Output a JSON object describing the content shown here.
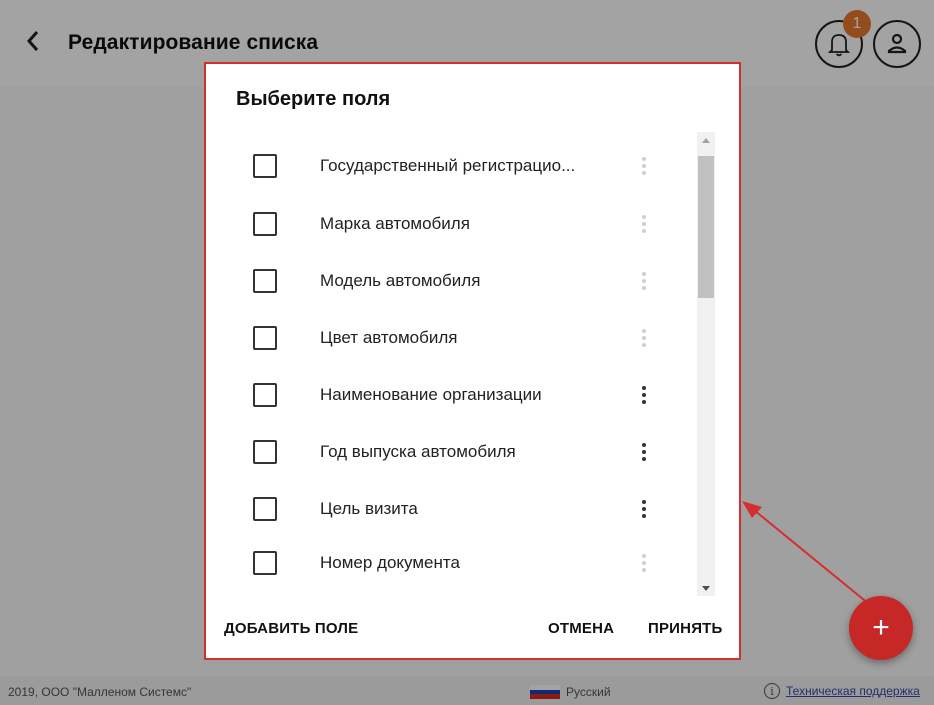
{
  "header": {
    "title": "Редактирование списка",
    "notifications_count": "1"
  },
  "dialog": {
    "title": "Выберите поля",
    "fields": [
      {
        "label": "Государственный регистрацио...",
        "checked": false,
        "handle": "faded"
      },
      {
        "label": "Марка автомобиля",
        "checked": false,
        "handle": "faded"
      },
      {
        "label": "Модель автомобиля",
        "checked": false,
        "handle": "faded"
      },
      {
        "label": "Цвет автомобиля",
        "checked": false,
        "handle": "faded"
      },
      {
        "label": "Наименование организации",
        "checked": false,
        "handle": "active"
      },
      {
        "label": "Год выпуска автомобиля",
        "checked": false,
        "handle": "active"
      },
      {
        "label": "Цель визита",
        "checked": false,
        "handle": "active"
      },
      {
        "label": "Номер документа",
        "checked": false,
        "handle": "faded"
      }
    ],
    "add_field_label": "ДОБАВИТЬ ПОЛЕ",
    "cancel_label": "ОТМЕНА",
    "accept_label": "ПРИНЯТЬ"
  },
  "fab": {
    "label": "+"
  },
  "footer": {
    "copyright": "2019, ООО \"Малленом Системс\"",
    "language": "Русский",
    "support": "Техническая поддержка"
  },
  "colors": {
    "dialog_border": "#d32f2f",
    "fab": "#c62828",
    "badge": "#e8782c",
    "arrow": "#d32f2f"
  },
  "icons": {
    "back": "chevron-left-icon",
    "bell": "bell-icon",
    "user": "user-icon",
    "drag": "drag-handle-icon",
    "info": "info-icon"
  }
}
